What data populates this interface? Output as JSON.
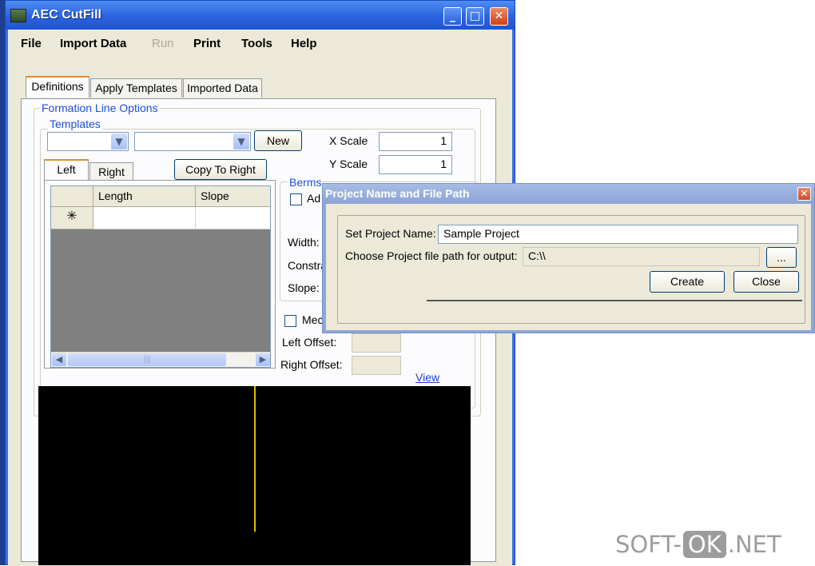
{
  "window": {
    "title": "AEC CutFill",
    "minimize_glyph": "_",
    "maximize_glyph": "□",
    "close_glyph": "✕"
  },
  "menu": {
    "file": "File",
    "import_data": "Import Data",
    "run": "Run",
    "print": "Print",
    "tools": "Tools",
    "help": "Help"
  },
  "tabs": {
    "definitions": "Definitions",
    "apply_templates": "Apply Templates",
    "imported_data": "Imported Data"
  },
  "formation": {
    "group_label": "Formation Line Options",
    "templates_label": "Templates",
    "new_button": "New",
    "x_scale_label": "X Scale",
    "x_scale_value": "1",
    "y_scale_label": "Y Scale",
    "y_scale_value": "1",
    "subtab_left": "Left",
    "subtab_right": "Right",
    "copy_to_right": "Copy To Right",
    "grid": {
      "col_length": "Length",
      "col_slope": "Slope",
      "new_row_marker": "✳"
    },
    "berms_label": "Berms",
    "add_label": "Ad",
    "width_label": "Width:",
    "constraint_label": "Constra",
    "slope_label": "Slope:",
    "median_label": "Mec",
    "left_offset_label": "Left Offset:",
    "right_offset_label": "Right Offset:",
    "view_link": "View",
    "scroll_thumb_glyph": "|||"
  },
  "dialog": {
    "title": "Project Name  and File Path",
    "project_name_label": "Set Project Name:",
    "project_name_value": "Sample Project",
    "file_path_label": "Choose Project file path for output:",
    "file_path_value": "C:\\\\",
    "browse_button": "...",
    "create_button": "Create",
    "close_button": "Close"
  },
  "watermark": {
    "part1": "SOFT-",
    "part2": "OK",
    "part3": ".NET"
  },
  "colors": {
    "title_bar": "#2b62dc",
    "accent_tab": "#e68b2c",
    "group_label": "#1f4fd8",
    "canvas_line": "#e0c000"
  }
}
